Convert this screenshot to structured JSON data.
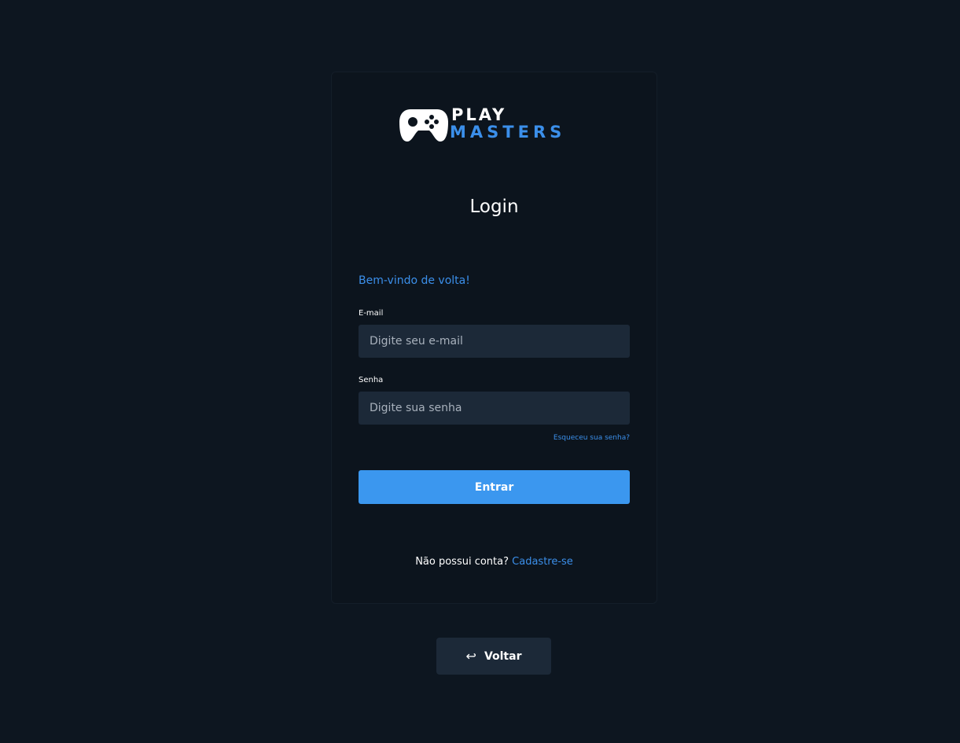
{
  "logo": {
    "line1": "PLAY",
    "line2": "MASTERS",
    "icon": "gamepad-icon"
  },
  "login": {
    "title": "Login",
    "welcome": "Bem-vindo de volta!",
    "email_label": "E-mail",
    "email_placeholder": "Digite seu e-mail",
    "password_label": "Senha",
    "password_placeholder": "Digite sua senha",
    "forgot_link": "Esqueceu sua senha?",
    "submit_label": "Entrar",
    "no_account_text": "Não possui conta?",
    "signup_link": "Cadastre-se"
  },
  "back_button": {
    "icon": "return-arrow-icon",
    "arrow_glyph": "↩",
    "label": "Voltar"
  },
  "colors": {
    "background": "#0d1620",
    "card": "#0c141d",
    "accent": "#3b8fea",
    "button": "#3b97ef",
    "input": "#1c2938"
  }
}
